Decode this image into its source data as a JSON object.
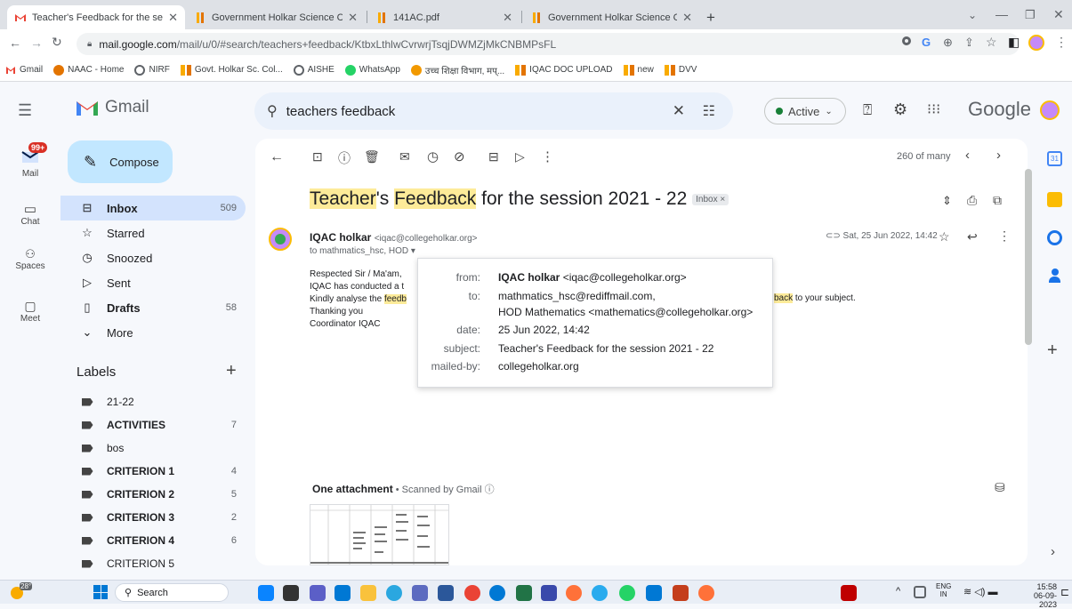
{
  "browser": {
    "tabs": [
      {
        "title": "Teacher's Feedback for the sessic",
        "active": true
      },
      {
        "title": "Government Holkar Science Colle",
        "active": false
      },
      {
        "title": "141AC.pdf",
        "active": false
      },
      {
        "title": "Government Holkar Science Colle",
        "active": false
      }
    ],
    "new_tab": "+",
    "url_host": "mail.google.com",
    "url_path": "/mail/u/0/#search/teachers+feedback/KtbxLthlwCvrwrjTsqjDWMZjMkCNBMPsFL",
    "bookmarks": [
      "Gmail",
      "NAAC - Home",
      "NIRF",
      "Govt. Holkar Sc. Col...",
      "AISHE",
      "WhatsApp",
      "उच्च शिक्षा विभाग, मप्...",
      "IQAC DOC UPLOAD",
      "new",
      "DVV"
    ]
  },
  "gmail": {
    "logo_text": "Gmail",
    "search_query": "teachers feedback",
    "status": "Active",
    "google_text": "Google",
    "rail": {
      "mail_badge": "99+",
      "mail": "Mail",
      "chat": "Chat",
      "spaces": "Spaces",
      "meet": "Meet"
    },
    "compose": "Compose",
    "nav": [
      {
        "label": "Inbox",
        "count": "509",
        "bold": true
      },
      {
        "label": "Starred",
        "count": "",
        "bold": false
      },
      {
        "label": "Snoozed",
        "count": "",
        "bold": false
      },
      {
        "label": "Sent",
        "count": "",
        "bold": false
      },
      {
        "label": "Drafts",
        "count": "58",
        "bold": true
      },
      {
        "label": "More",
        "count": "",
        "bold": false
      }
    ],
    "labels_heading": "Labels",
    "labels": [
      {
        "name": "21-22",
        "count": "",
        "bold": false
      },
      {
        "name": "ACTIVITIES",
        "count": "7",
        "bold": true
      },
      {
        "name": "bos",
        "count": "",
        "bold": false
      },
      {
        "name": "CRITERION 1",
        "count": "4",
        "bold": true
      },
      {
        "name": "CRITERION 2",
        "count": "5",
        "bold": true
      },
      {
        "name": "CRITERION 3",
        "count": "2",
        "bold": true
      },
      {
        "name": "CRITERION 4",
        "count": "6",
        "bold": true
      },
      {
        "name": "CRITERION 5",
        "count": "",
        "bold": false
      }
    ],
    "pager": "260 of many",
    "email": {
      "subject_a": "Teacher",
      "subject_b": "'s ",
      "subject_c": "Feedback",
      "subject_d": " for the session 2021 - 22",
      "inbox_chip": "Inbox ×",
      "sender_name": "IQAC holkar",
      "sender_email": "<iqac@collegeholkar.org>",
      "to_line": "to mathmatics_hsc, HOD ▾",
      "date": "Sat, 25 Jun 2022, 14:42",
      "body": [
        "Respected Sir / Ma'am,",
        "IQAC has conducted a t",
        "Kindly analyse the ",
        "Thanking you",
        "Coordinator IQAC"
      ],
      "body_hl_feedb": "feedb",
      "body_tail": "back",
      "body_tail_rest": " to your subject.",
      "attachment_title": "One attachment",
      "attachment_note": " • Scanned by Gmail ⓘ"
    },
    "details": {
      "from_label": "from:",
      "from_name": "IQAC holkar",
      "from_email": " <iqac@collegeholkar.org>",
      "to_label": "to:",
      "to_1": "mathmatics_hsc@rediffmail.com,",
      "to_2": "HOD Mathematics <mathematics@collegeholkar.org>",
      "date_label": "date:",
      "date": "25 Jun 2022, 14:42",
      "subject_label": "subject:",
      "subject": "Teacher's Feedback for the session 2021 - 22",
      "mailedby_label": "mailed-by:",
      "mailedby": "collegeholkar.org"
    }
  },
  "taskbar": {
    "weather": "28°",
    "search": "Search",
    "lang_1": "ENG",
    "lang_2": "IN",
    "time": "15:58",
    "date": "06-09-2023"
  },
  "colors": {
    "accent": "#1a73e8",
    "highlight": "#fdeb99",
    "compose_bg": "#c2e7ff",
    "badge": "#d93025",
    "active": "#188038"
  }
}
